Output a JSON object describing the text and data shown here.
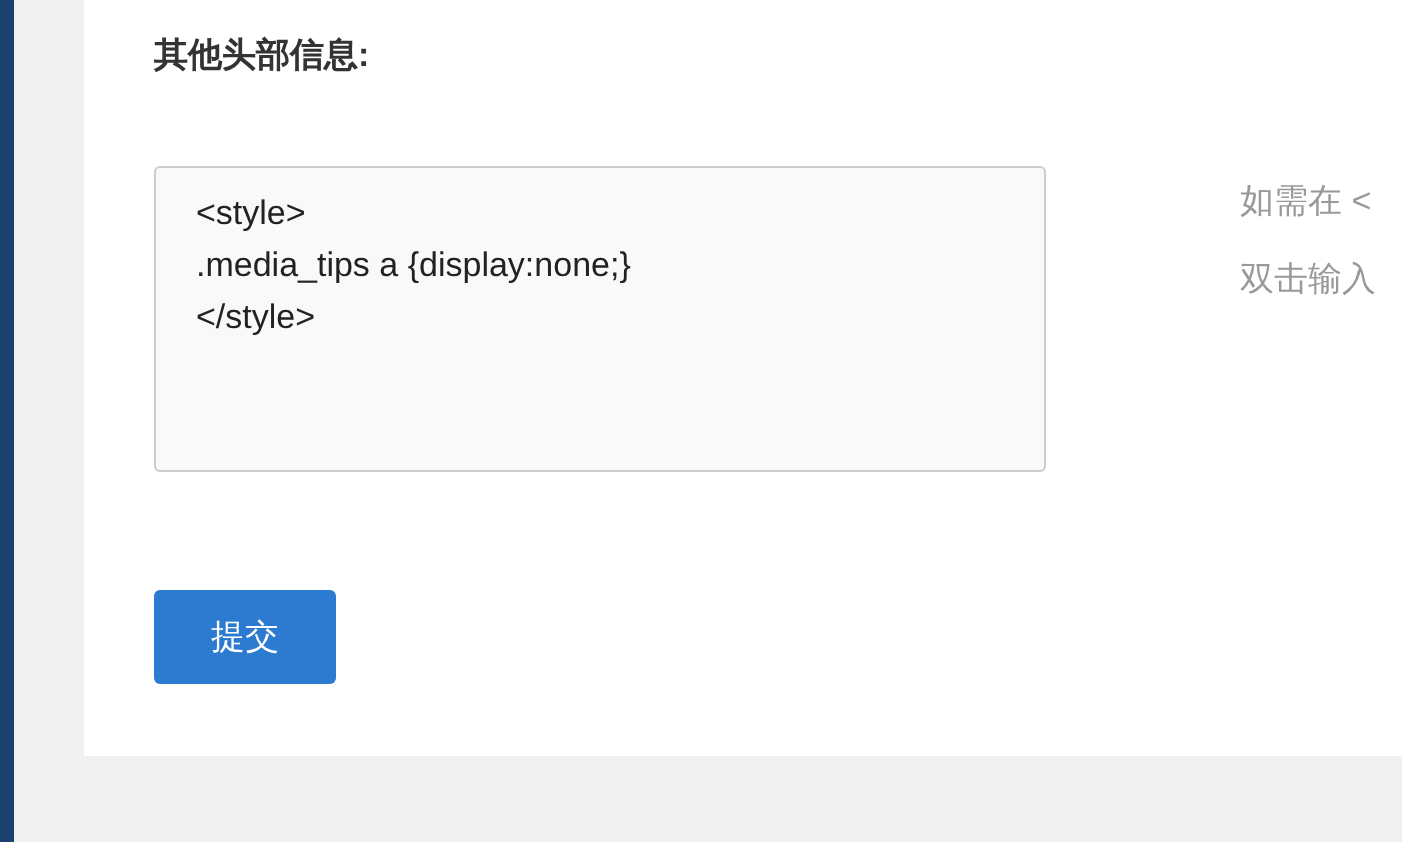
{
  "section": {
    "label": "其他头部信息:"
  },
  "field": {
    "value": "<style>\n.media_tips a {display:none;}\n</style>"
  },
  "hints": [
    "如需在 <",
    "双击输入"
  ],
  "buttons": [
    {
      "label": "提交"
    }
  ]
}
